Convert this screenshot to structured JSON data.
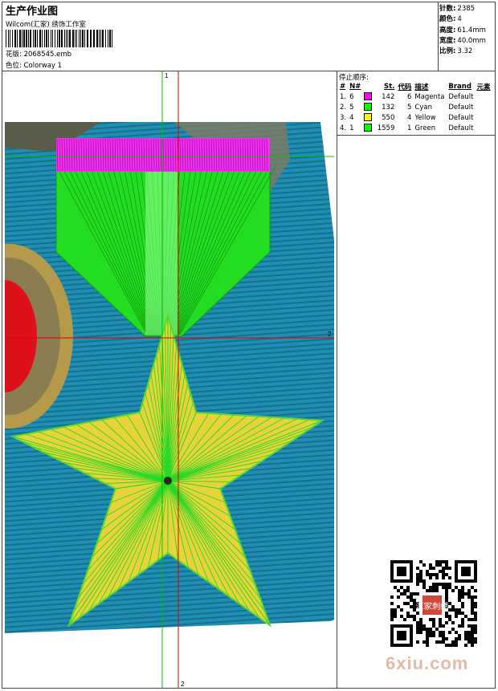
{
  "header": {
    "title": "生产作业图",
    "company": "Wilcom(汇家) 绣饰工作室",
    "design_label": "花版:",
    "design_value": "2068545.emb",
    "colorway_label": "色位:",
    "colorway_value": "Colorway 1"
  },
  "stats": [
    {
      "label": "针数:",
      "value": "2385"
    },
    {
      "label": "颜色:",
      "value": "4"
    },
    {
      "label": "高度:",
      "value": "61.4mm"
    },
    {
      "label": "宽度:",
      "value": "40.0mm"
    },
    {
      "label": "比例:",
      "value": "3.32"
    }
  ],
  "stop_sequence": {
    "title": "停止顺序:",
    "headers": {
      "order": "#",
      "needle": "N#",
      "st": "St.",
      "code": "代码",
      "desc": "描述",
      "brand": "Brand",
      "element": "元素"
    },
    "rows": [
      {
        "order": "1.",
        "needle": "6",
        "color": "#ff00ff",
        "st": "142",
        "code": "6",
        "desc": "Magenta",
        "brand": "Default"
      },
      {
        "order": "2.",
        "needle": "5",
        "color": "#00ff00",
        "st": "132",
        "code": "5",
        "desc": "Cyan",
        "brand": "Default"
      },
      {
        "order": "3.",
        "needle": "4",
        "color": "#ffff00",
        "st": "550",
        "code": "4",
        "desc": "Yellow",
        "brand": "Default"
      },
      {
        "order": "4.",
        "needle": "1",
        "color": "#00ff00",
        "st": "1559",
        "code": "1",
        "desc": "Green",
        "brand": "Default"
      }
    ]
  },
  "guides": {
    "top_marker": "1",
    "right_marker": "2",
    "bottom_marker": "2"
  },
  "watermark": "6xiu.com",
  "qr_seal": "汇家刺绣"
}
